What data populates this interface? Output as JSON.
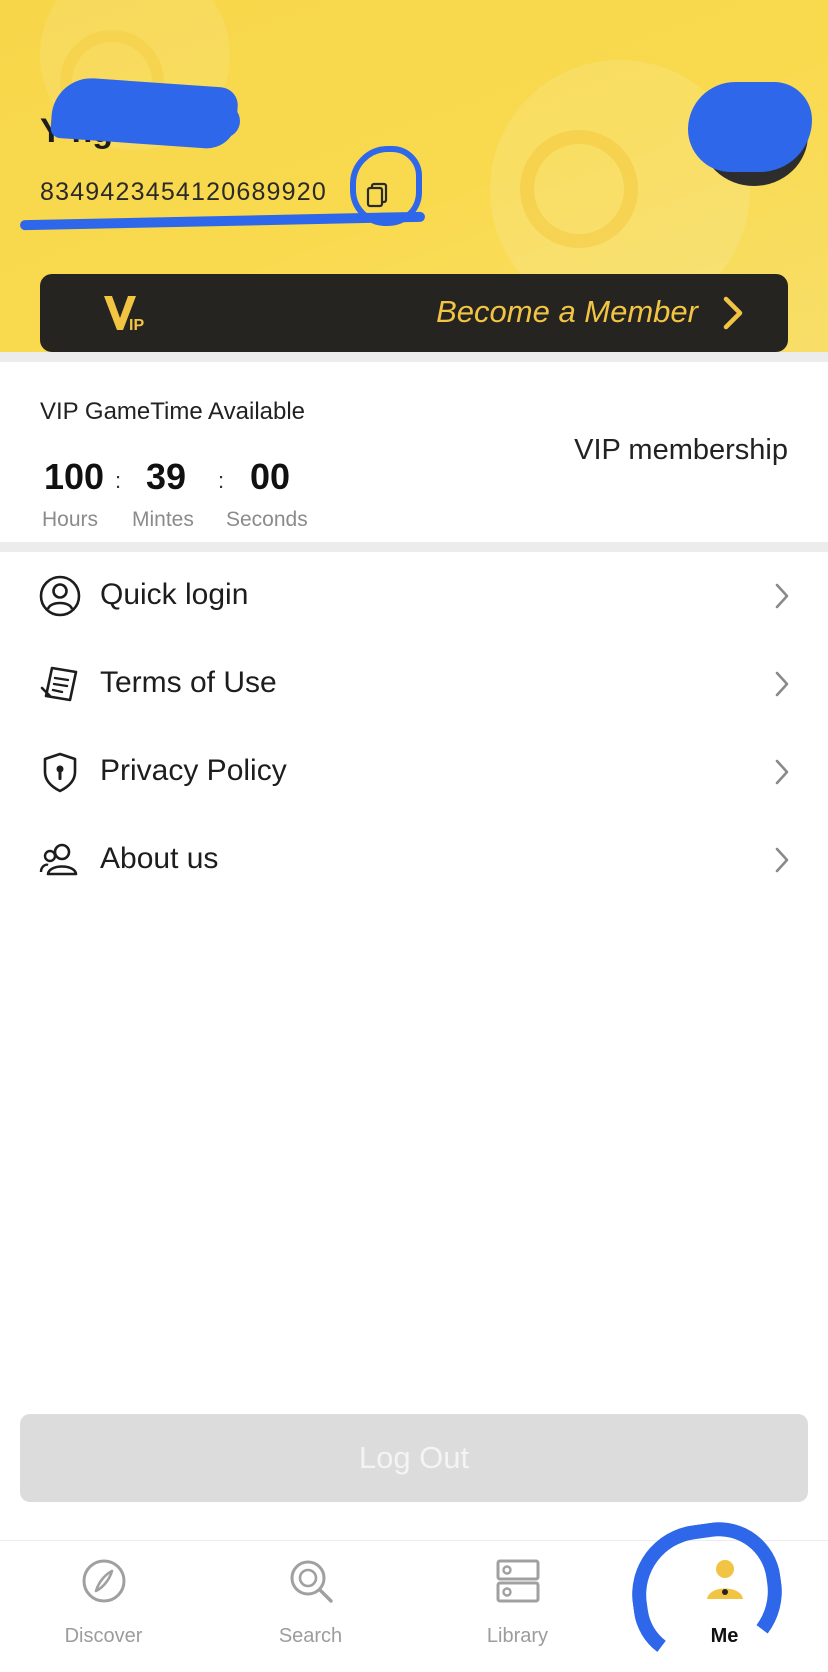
{
  "profile": {
    "name": "Y          ng",
    "user_id": "834942345412068992​0",
    "copy_icon": "copy-icon"
  },
  "vip_banner": {
    "logo_text": "VIP",
    "label": "Become a Member"
  },
  "vip_time": {
    "title": "VIP GameTime Available",
    "hours": "100",
    "minutes": "39",
    "seconds": "00",
    "sep": ":",
    "hours_label": "Hours",
    "minutes_label": "Mintes",
    "seconds_label": "Seconds",
    "membership_link": "VIP membership"
  },
  "menu": {
    "items": [
      {
        "label": "Quick login",
        "icon": "user-circle-icon"
      },
      {
        "label": "Terms of Use",
        "icon": "document-icon"
      },
      {
        "label": "Privacy Policy",
        "icon": "shield-icon"
      },
      {
        "label": "About us",
        "icon": "group-icon"
      }
    ]
  },
  "logout": {
    "label": "Log Out"
  },
  "tabbar": {
    "tabs": [
      {
        "label": "Discover",
        "icon": "compass-icon"
      },
      {
        "label": "Search",
        "icon": "search-icon"
      },
      {
        "label": "Library",
        "icon": "library-icon"
      },
      {
        "label": "Me",
        "icon": "person-icon",
        "active": true
      }
    ]
  },
  "colors": {
    "header_yellow": "#f9da4f",
    "vip_gold": "#f2c443",
    "banner_dark": "#262421",
    "scribble_blue": "#2f67ea"
  }
}
